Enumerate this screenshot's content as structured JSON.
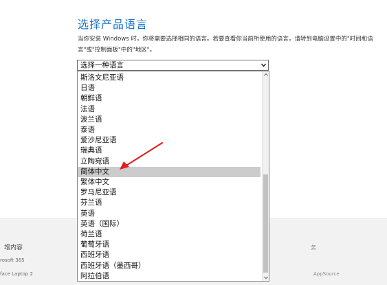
{
  "title": "选择产品语言",
  "description": "当你安装 Windows 时，你将需要选择相同的语言。若要查看你当前所使用的语言，请转到电脑设置中的\"时间和语言\"或\"控制面板\"中的\"地区\"。",
  "select": {
    "value": "选择一种语言"
  },
  "options": [
    "斯洛文尼亚语",
    "日语",
    "朝鲜语",
    "法语",
    "波兰语",
    "泰语",
    "爱沙尼亚语",
    "瑞典语",
    "立陶宛语",
    "简体中文",
    "繁体中文",
    "罗马尼亚语",
    "芬兰语",
    "英语",
    "英语（国际）",
    "荷兰语",
    "葡萄牙语",
    "西班牙语",
    "西班牙语（墨西哥）",
    "阿拉伯语"
  ],
  "highlighted_index": 9,
  "footer": {
    "left_title": "增内容",
    "left_items": [
      "rosoft 365",
      "face Laptop 2"
    ],
    "right_title": "务",
    "right_item": "AppSource"
  },
  "colors": {
    "title": "#1a73c8",
    "highlight": "#cccccc",
    "arrow": "#e02020"
  },
  "icons": {
    "caret": "chevron-down-icon",
    "annotation": "red-arrow-icon"
  }
}
